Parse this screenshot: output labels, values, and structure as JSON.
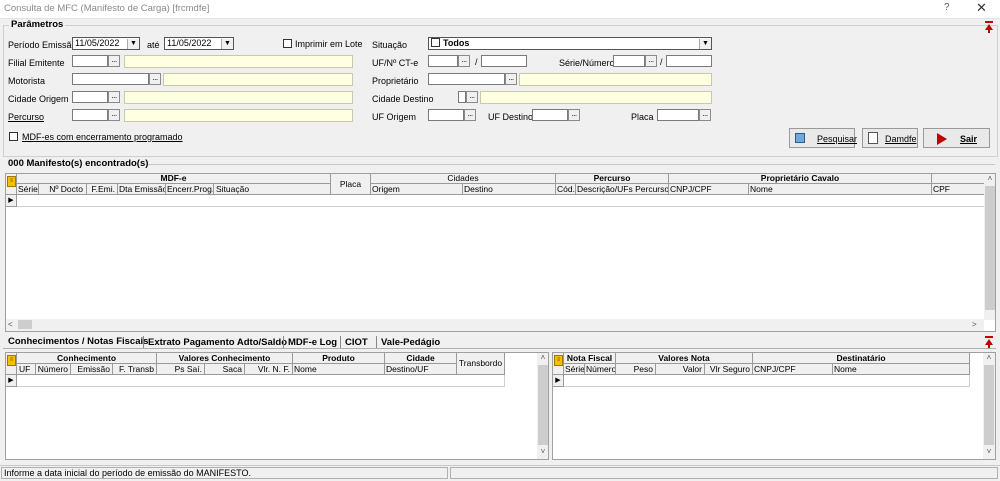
{
  "window": {
    "title": "Consulta de MFC (Manifesto de Carga) [frcmdfe]",
    "help": "?",
    "close": "✕"
  },
  "params": {
    "title": "Parâmetros",
    "periodo_label": "Período Emissão",
    "data_ini": "11/05/2022",
    "ate_label": "até",
    "data_fim": "11/05/2022",
    "imprimir_label": "Imprimir em Lote",
    "filial_label": "Filial Emitente",
    "motorista_label": "Motorista",
    "cidade_origem_label": "Cidade Origem",
    "percurso_label": "Percurso",
    "situacao_label": "Situação",
    "situacao_value": "Todos",
    "uf_cte_label": "UF/Nº CT-e",
    "slash1": "/",
    "serie_numero_label": "Série/Número",
    "slash2": "/",
    "proprietario_label": "Proprietário",
    "cidade_destino_label": "Cidade Destino",
    "uf_origem_label": "UF Origem",
    "uf_destino_label": "UF Destino",
    "placa_label": "Placa",
    "mdfe_enc_label": "MDF-es com encerramento programado",
    "dots": "..."
  },
  "buttons": {
    "pesquisar": "Pesquisar",
    "damdfe": "Damdfe",
    "sair": "Sair"
  },
  "manifestos": {
    "count_label": "000 Manifesto(s) encontrado(s)",
    "groups": {
      "mdfe": "MDF-e",
      "placa": "Placa",
      "cidades": "Cidades",
      "percurso": "Percurso",
      "proprietario": "Proprietário Cavalo"
    },
    "columns": [
      "Série",
      "Nº Docto",
      "F.Emi.",
      "Dta Emissão",
      "Encerr.Prog.",
      "Situação",
      "Origem",
      "Destino",
      "Cód.",
      "Descrição/UFs Percurso",
      "CNPJ/CPF",
      "Nome",
      "CPF"
    ]
  },
  "tabs": [
    "Conhecimentos / Notas Fiscais",
    "Extrato Pagamento Adto/Saldo",
    "MDF-e Log",
    "CIOT",
    "Vale-Pedágio"
  ],
  "conhecimentos": {
    "groups": {
      "conhecimento": "Conhecimento",
      "valores": "Valores Conhecimento",
      "produto": "Produto",
      "cidade": "Cidade",
      "transbordo": "Transbordo"
    },
    "columns": [
      "UF",
      "Número",
      "Emissão",
      "F. Transb",
      "Ps Saí.",
      "Saca",
      "Vlr. N. F.",
      "Nome",
      "Destino/UF"
    ]
  },
  "notas": {
    "groups": {
      "nota": "Nota Fiscal",
      "valores": "Valores Nota",
      "destinatario": "Destinatário"
    },
    "columns": [
      "Série",
      "Número",
      "Peso",
      "Valor",
      "Vlr Seguro",
      "CNPJ/CPF",
      "Nome"
    ]
  },
  "status": {
    "message": "Informe a data inicial do período de emissão do MANIFESTO."
  },
  "icons": {
    "expand": "red-up-arrow-icon",
    "grid_menu": "yellow-grid-menu-icon"
  }
}
